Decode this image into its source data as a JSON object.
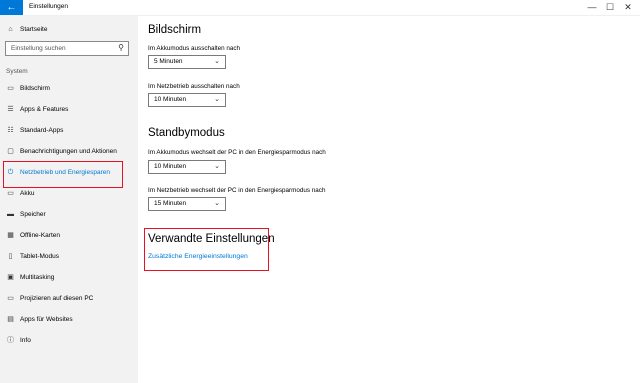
{
  "window": {
    "title": "Einstellungen",
    "back_glyph": "←",
    "minimize_glyph": "—",
    "maximize_glyph": "☐",
    "close_glyph": "✕"
  },
  "sidebar": {
    "home": {
      "label": "Startseite",
      "icon": "home-icon",
      "glyph": "⌂"
    },
    "search": {
      "placeholder": "Einstellung suchen",
      "icon": "search-icon",
      "glyph": "⚲"
    },
    "section": "System",
    "items": [
      {
        "label": "Bildschirm",
        "icon": "monitor-icon",
        "glyph": "▭"
      },
      {
        "label": "Apps & Features",
        "icon": "list-icon",
        "glyph": "☰"
      },
      {
        "label": "Standard-Apps",
        "icon": "default-apps-icon",
        "glyph": "☷"
      },
      {
        "label": "Benachrichtigungen und Aktionen",
        "icon": "notification-icon",
        "glyph": "▢"
      },
      {
        "label": "Netzbetrieb und Energiesparen",
        "icon": "power-icon",
        "glyph": "⏻",
        "active": true
      },
      {
        "label": "Akku",
        "icon": "battery-icon",
        "glyph": "▭"
      },
      {
        "label": "Speicher",
        "icon": "storage-icon",
        "glyph": "▬"
      },
      {
        "label": "Offline-Karten",
        "icon": "map-icon",
        "glyph": "▦"
      },
      {
        "label": "Tablet-Modus",
        "icon": "tablet-icon",
        "glyph": "▯"
      },
      {
        "label": "Multitasking",
        "icon": "multitasking-icon",
        "glyph": "▣"
      },
      {
        "label": "Projizieren auf diesen PC",
        "icon": "project-icon",
        "glyph": "▭"
      },
      {
        "label": "Apps für Websites",
        "icon": "web-apps-icon",
        "glyph": "▤"
      },
      {
        "label": "Info",
        "icon": "info-icon",
        "glyph": "ⓘ"
      }
    ]
  },
  "main": {
    "screen": {
      "title": "Bildschirm",
      "battery_label": "Im Akkumodus ausschalten nach",
      "battery_value": "5 Minuten",
      "power_label": "Im Netzbetrieb ausschalten nach",
      "power_value": "10 Minuten"
    },
    "standby": {
      "title": "Standbymodus",
      "battery_label": "Im Akkumodus wechselt der PC in den Energiesparmodus nach",
      "battery_value": "10 Minuten",
      "power_label": "Im Netzbetrieb wechselt der PC in den Energiesparmodus nach",
      "power_value": "15 Minuten"
    },
    "related": {
      "title": "Verwandte Einstellungen",
      "link": "Zusätzliche Energieeinstellungen"
    },
    "chevron": "⌄"
  },
  "colors": {
    "accent": "#0078d7",
    "highlight_box": "#e81123",
    "sidebar_bg": "#f2f2f2"
  }
}
